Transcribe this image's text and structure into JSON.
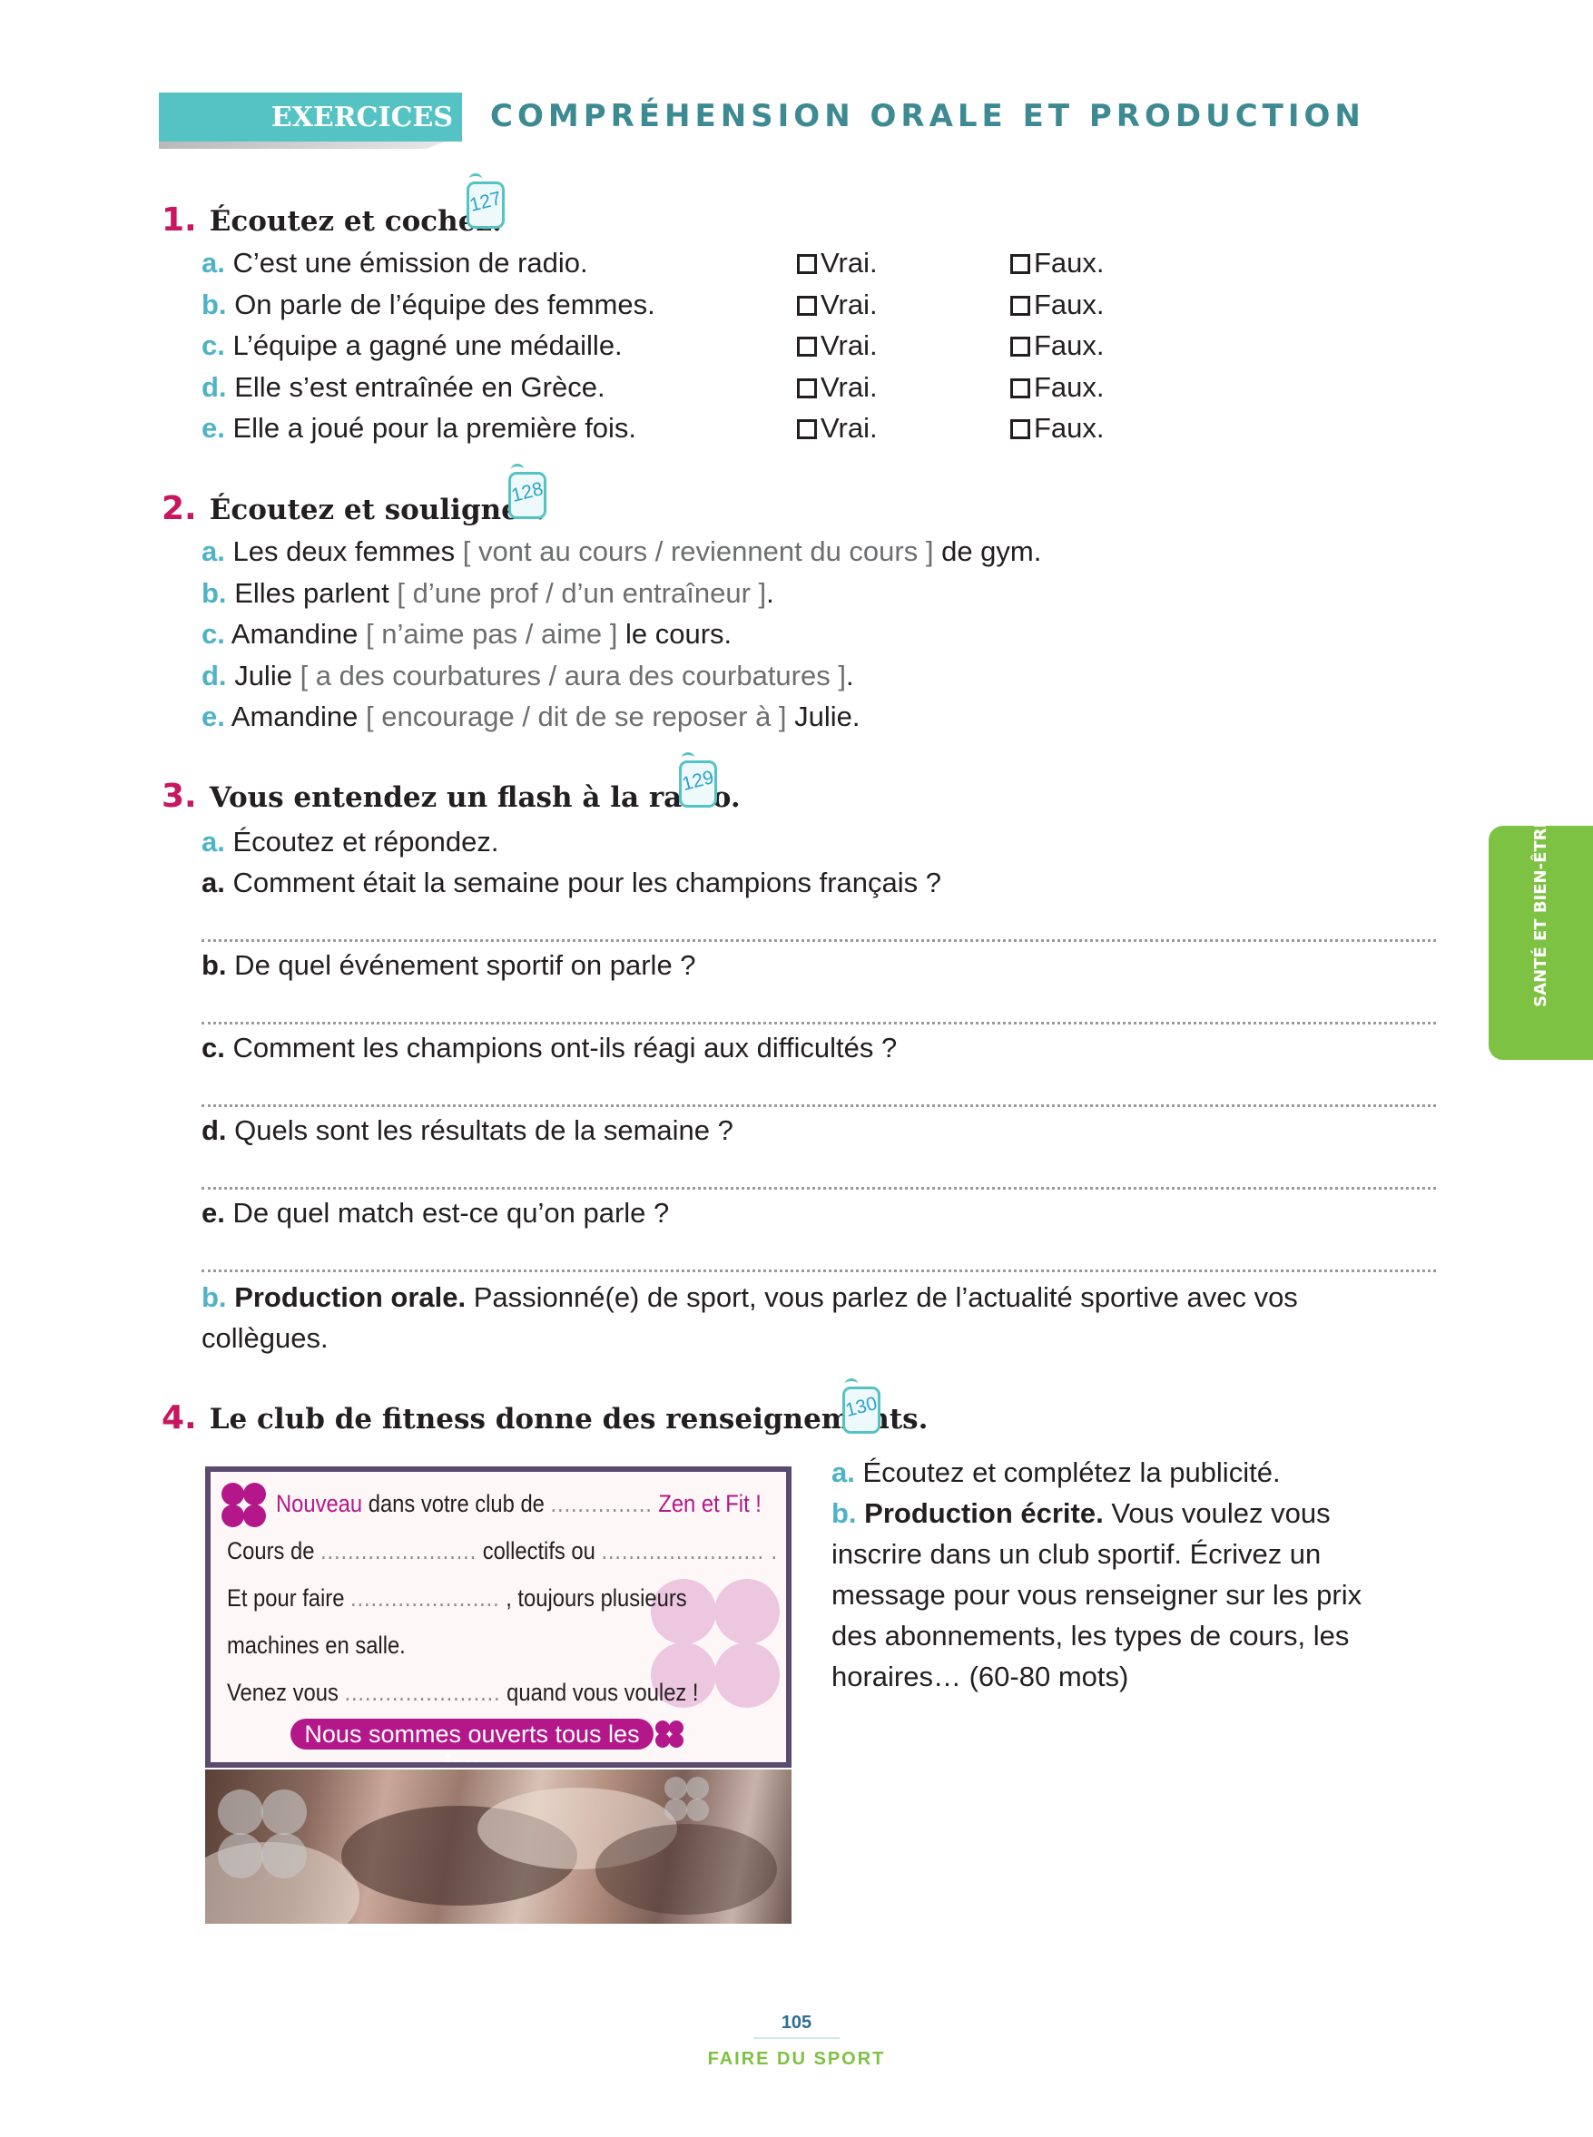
{
  "header": {
    "tab_label": "EXERCICES",
    "section_title": "COMPRÉHENSION ORALE ET PRODUCTION"
  },
  "side_tab": "SANTÉ ET BIEN-ÊTRE",
  "ex1": {
    "number": "1.",
    "instruction": "Écoutez et cochez.",
    "track": "127",
    "true_label": "Vrai.",
    "false_label": "Faux.",
    "items": [
      {
        "letter": "a.",
        "text": "C’est une émission de radio."
      },
      {
        "letter": "b.",
        "text": "On parle de l’équipe des femmes."
      },
      {
        "letter": "c.",
        "text": "L’équipe a gagné une médaille."
      },
      {
        "letter": "d.",
        "text": "Elle s’est entraînée en Grèce."
      },
      {
        "letter": "e.",
        "text": "Elle a joué pour la première fois."
      }
    ]
  },
  "ex2": {
    "number": "2.",
    "instruction": "Écoutez et soulignez.",
    "track": "128",
    "items": [
      {
        "letter": "a.",
        "before": "Les deux femmes ",
        "choice": "[ vont au cours / reviennent du cours ]",
        "after": " de gym."
      },
      {
        "letter": "b.",
        "before": "Elles parlent ",
        "choice": "[ d’une prof / d’un entraîneur ]",
        "after": "."
      },
      {
        "letter": "c.",
        "before": "Amandine ",
        "choice": "[ n’aime pas / aime ]",
        "after": " le cours."
      },
      {
        "letter": "d.",
        "before": "Julie ",
        "choice": "[ a des courbatures / aura des courbatures ]",
        "after": "."
      },
      {
        "letter": "e.",
        "before": "Amandine ",
        "choice": "[ encourage / dit de se reposer à ]",
        "after": " Julie."
      }
    ]
  },
  "ex3": {
    "number": "3.",
    "instruction": "Vous entendez un flash à la radio.",
    "track": "129",
    "part_a_letter": "a.",
    "part_a": "Écoutez et répondez.",
    "questions": [
      {
        "letter": "a.",
        "text": " Comment était la semaine pour les champions français ?"
      },
      {
        "letter": "b.",
        "text": " De quel événement sportif on parle ?"
      },
      {
        "letter": "c.",
        "text": " Comment les champions ont-ils réagi aux difficultés ?"
      },
      {
        "letter": "d.",
        "text": " Quels sont les résultats de la semaine ?"
      },
      {
        "letter": "e.",
        "text": " De quel match est-ce qu’on parle ?"
      }
    ],
    "part_b_letter": "b.",
    "part_b_bold": "Production orale.",
    "part_b_line1": " Passionné(e) de sport, vous parlez de l’actualité sportive avec vos",
    "part_b_line2": "collègues."
  },
  "ex4": {
    "number": "4.",
    "instruction": "Le club de fitness donne des renseignements.",
    "track": "130",
    "ad": {
      "l1_a": "Nouveau",
      "l1_b": " dans votre club de ",
      "l1_dots": "...............",
      "l1_c": " Zen et Fit !",
      "l2_a": "Cours de ",
      "l2_dots1": ".......................",
      "l2_b": " collectifs ou ",
      "l2_dots2": "........................ .",
      "l3_a": "Et pour faire ",
      "l3_dots": "......................",
      "l3_b": " , toujours plusieurs",
      "l4": "machines en salle.",
      "l5_a": "Venez vous ",
      "l5_dots": ".......................",
      "l5_b": " quand vous voulez !",
      "banner": "Nous sommes ouverts tous les jours"
    },
    "a_letter": "a.",
    "a_text": " Écoutez et complétez la publicité.",
    "b_letter": "b.",
    "b_bold": " Production écrite.",
    "b_lines": [
      " Vous voulez vous",
      "inscrire dans un club sportif. Écrivez un",
      "message pour vous renseigner sur les prix",
      "des abonnements, les types de cours, les",
      "horaires… (60-80 mots)"
    ]
  },
  "footer": {
    "page_number": "105",
    "chapter": "FAIRE DU SPORT"
  },
  "colors": {
    "teal": "#55c3c4",
    "magenta_number": "#c8165f",
    "letter_blue": "#4fb3c7",
    "side_green": "#7dc242",
    "ad_magenta": "#b4178a"
  }
}
